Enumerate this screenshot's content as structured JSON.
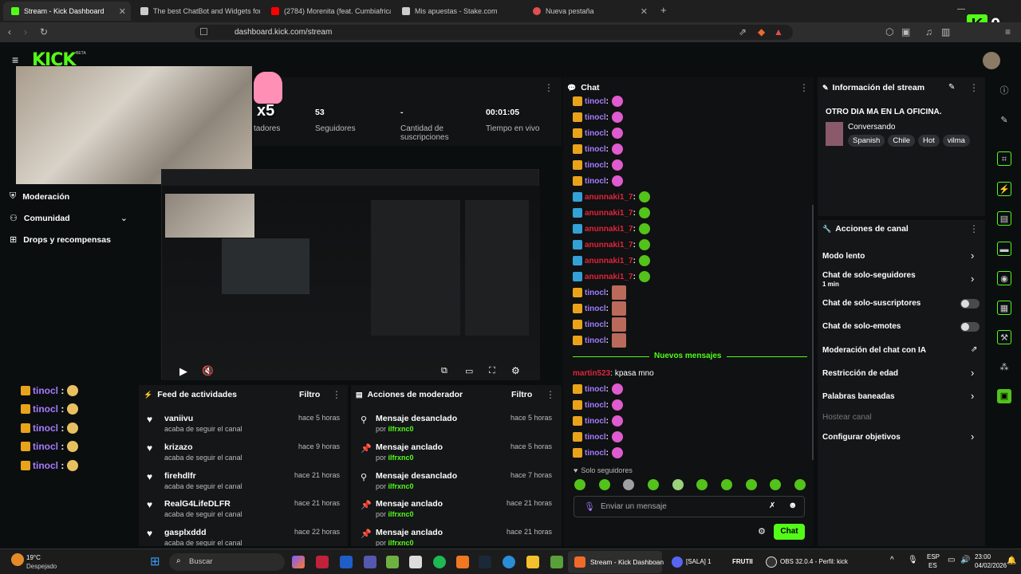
{
  "browser": {
    "tabs": [
      {
        "title": "Stream - Kick Dashboard",
        "color": "#53fc18"
      },
      {
        "title": "The best ChatBot and Widgets for Ki",
        "color": "#cccccc"
      },
      {
        "title": "(2784) Morenita (feat. Cumbiafrica) -",
        "color": "#ff0000"
      },
      {
        "title": "Mis apuestas - Stake.com",
        "color": "#cccccc"
      },
      {
        "title": "Nueva pestaña",
        "color": "#e05050"
      }
    ],
    "url": "dashboard.kick.com/stream"
  },
  "header": {
    "logo": "KICK",
    "beta": "BETA"
  },
  "stats": {
    "followers_value": "53",
    "followers_label": "Seguidores",
    "subs_value": "-",
    "subs_label": "Cantidad de suscripciones",
    "uptime_value": "00:01:05",
    "uptime_label": "Tiempo en vivo",
    "viewers_label": "tadores",
    "overlay_multiplier": "x5"
  },
  "nav": {
    "moderation": "Moderación",
    "community": "Comunidad",
    "drops": "Drops y recompensas"
  },
  "overlay_chat": [
    {
      "user": "tinocl",
      "sep": ":"
    },
    {
      "user": "tinocl",
      "sep": ":"
    },
    {
      "user": "tinocl",
      "sep": ":"
    },
    {
      "user": "tinocl",
      "sep": ":"
    },
    {
      "user": "tinocl",
      "sep": ":"
    }
  ],
  "feed": {
    "title": "Feed de actividades",
    "filter": "Filtro",
    "items": [
      {
        "user": "vaniivu",
        "action": "acaba de seguir el canal",
        "time": "hace 5 horas"
      },
      {
        "user": "krizazo",
        "action": "acaba de seguir el canal",
        "time": "hace 9 horas"
      },
      {
        "user": "firehdlfr",
        "action": "acaba de seguir el canal",
        "time": "hace 21 horas"
      },
      {
        "user": "RealG4LifeDLFR",
        "action": "acaba de seguir el canal",
        "time": "hace 21 horas"
      },
      {
        "user": "gasplxddd",
        "action": "acaba de seguir el canal",
        "time": "hace 22 horas"
      }
    ]
  },
  "modactions": {
    "title": "Acciones de moderador",
    "filter": "Filtro",
    "items": [
      {
        "action": "Mensaje desanclado",
        "by": "por",
        "user": "ilfrxnc0",
        "time": "hace 5 horas"
      },
      {
        "action": "Mensaje anclado",
        "by": "por",
        "user": "ilfrxnc0",
        "time": "hace 5 horas"
      },
      {
        "action": "Mensaje desanclado",
        "by": "por",
        "user": "ilfrxnc0",
        "time": "hace 7 horas"
      },
      {
        "action": "Mensaje anclado",
        "by": "por",
        "user": "ilfrxnc0",
        "time": "hace 21 horas"
      },
      {
        "action": "Mensaje anclado",
        "by": "por",
        "user": "ilfrxnc0",
        "time": "hace 21 horas"
      }
    ]
  },
  "chat": {
    "title": "Chat",
    "new_messages": "Nuevos mensajes",
    "followers_only": "Solo seguidores",
    "placeholder": "Enviar un mensaje",
    "send": "Chat",
    "lines_top": [
      {
        "user": "tinocl",
        "badge": "crown",
        "color": "#a47bff"
      },
      {
        "user": "tinocl",
        "badge": "crown",
        "color": "#a47bff"
      },
      {
        "user": "tinocl",
        "badge": "crown",
        "color": "#a47bff"
      },
      {
        "user": "tinocl",
        "badge": "crown",
        "color": "#a47bff"
      },
      {
        "user": "tinocl",
        "badge": "crown",
        "color": "#a47bff"
      },
      {
        "user": "tinocl",
        "badge": "crown",
        "color": "#a47bff"
      },
      {
        "user": "anunnaki1_7",
        "badge": "tool",
        "color": "#e0243a"
      },
      {
        "user": "anunnaki1_7",
        "badge": "tool",
        "color": "#e0243a"
      },
      {
        "user": "anunnaki1_7",
        "badge": "tool",
        "color": "#e0243a"
      },
      {
        "user": "anunnaki1_7",
        "badge": "tool",
        "color": "#e0243a"
      },
      {
        "user": "anunnaki1_7",
        "badge": "tool",
        "color": "#e0243a"
      },
      {
        "user": "anunnaki1_7",
        "badge": "tool",
        "color": "#e0243a"
      },
      {
        "user": "tinocl",
        "badge": "crown",
        "color": "#a47bff"
      },
      {
        "user": "tinocl",
        "badge": "crown",
        "color": "#a47bff"
      },
      {
        "user": "tinocl",
        "badge": "crown",
        "color": "#a47bff"
      },
      {
        "user": "tinocl",
        "badge": "crown",
        "color": "#a47bff"
      }
    ],
    "martin_user": "martin523",
    "martin_msg": "kpasa mno",
    "lines_bottom": [
      {
        "user": "tinocl"
      },
      {
        "user": "tinocl"
      },
      {
        "user": "tinocl"
      },
      {
        "user": "tinocl"
      },
      {
        "user": "tinocl"
      }
    ]
  },
  "streaminfo": {
    "title": "Información del stream",
    "stream_title": "OTRO DIA MA EN LA OFICINA.",
    "category": "Conversando",
    "tags": [
      "Spanish",
      "Chile",
      "Hot",
      "vilma"
    ]
  },
  "channel_actions": {
    "title": "Acciones de canal",
    "slow": "Modo lento",
    "followers_only": "Chat de solo-seguidores",
    "followers_only_sub": "1 min",
    "subs_only": "Chat de solo-suscriptores",
    "emotes_only": "Chat de solo-emotes",
    "ai_mod": "Moderación del chat con IA",
    "age": "Restricción de edad",
    "banned": "Palabras baneadas",
    "host": "Hostear canal",
    "goals": "Configurar objetivos"
  },
  "taskbar": {
    "temp": "19°C",
    "weather": "Despejado",
    "search": "Buscar",
    "app_kick": "Stream - Kick Dashboan",
    "app_discord": "[SALA] 1",
    "app_frutii": "FRUTII",
    "app_obs": "OBS 32.0.4 - Perfil: kick",
    "lang": "ESP",
    "lang2": "ES",
    "time": "23:00",
    "date": "04/02/2026"
  }
}
